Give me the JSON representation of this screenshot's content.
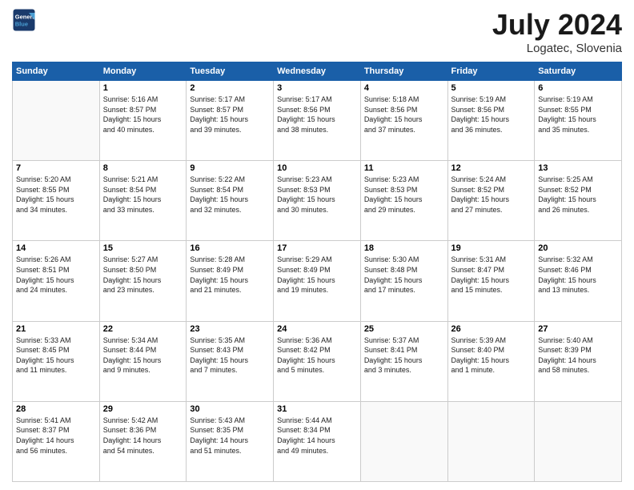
{
  "header": {
    "logo_line1": "General",
    "logo_line2": "Blue",
    "month": "July 2024",
    "location": "Logatec, Slovenia"
  },
  "weekdays": [
    "Sunday",
    "Monday",
    "Tuesday",
    "Wednesday",
    "Thursday",
    "Friday",
    "Saturday"
  ],
  "weeks": [
    [
      {
        "day": "",
        "info": ""
      },
      {
        "day": "1",
        "info": "Sunrise: 5:16 AM\nSunset: 8:57 PM\nDaylight: 15 hours\nand 40 minutes."
      },
      {
        "day": "2",
        "info": "Sunrise: 5:17 AM\nSunset: 8:57 PM\nDaylight: 15 hours\nand 39 minutes."
      },
      {
        "day": "3",
        "info": "Sunrise: 5:17 AM\nSunset: 8:56 PM\nDaylight: 15 hours\nand 38 minutes."
      },
      {
        "day": "4",
        "info": "Sunrise: 5:18 AM\nSunset: 8:56 PM\nDaylight: 15 hours\nand 37 minutes."
      },
      {
        "day": "5",
        "info": "Sunrise: 5:19 AM\nSunset: 8:56 PM\nDaylight: 15 hours\nand 36 minutes."
      },
      {
        "day": "6",
        "info": "Sunrise: 5:19 AM\nSunset: 8:55 PM\nDaylight: 15 hours\nand 35 minutes."
      }
    ],
    [
      {
        "day": "7",
        "info": "Sunrise: 5:20 AM\nSunset: 8:55 PM\nDaylight: 15 hours\nand 34 minutes."
      },
      {
        "day": "8",
        "info": "Sunrise: 5:21 AM\nSunset: 8:54 PM\nDaylight: 15 hours\nand 33 minutes."
      },
      {
        "day": "9",
        "info": "Sunrise: 5:22 AM\nSunset: 8:54 PM\nDaylight: 15 hours\nand 32 minutes."
      },
      {
        "day": "10",
        "info": "Sunrise: 5:23 AM\nSunset: 8:53 PM\nDaylight: 15 hours\nand 30 minutes."
      },
      {
        "day": "11",
        "info": "Sunrise: 5:23 AM\nSunset: 8:53 PM\nDaylight: 15 hours\nand 29 minutes."
      },
      {
        "day": "12",
        "info": "Sunrise: 5:24 AM\nSunset: 8:52 PM\nDaylight: 15 hours\nand 27 minutes."
      },
      {
        "day": "13",
        "info": "Sunrise: 5:25 AM\nSunset: 8:52 PM\nDaylight: 15 hours\nand 26 minutes."
      }
    ],
    [
      {
        "day": "14",
        "info": "Sunrise: 5:26 AM\nSunset: 8:51 PM\nDaylight: 15 hours\nand 24 minutes."
      },
      {
        "day": "15",
        "info": "Sunrise: 5:27 AM\nSunset: 8:50 PM\nDaylight: 15 hours\nand 23 minutes."
      },
      {
        "day": "16",
        "info": "Sunrise: 5:28 AM\nSunset: 8:49 PM\nDaylight: 15 hours\nand 21 minutes."
      },
      {
        "day": "17",
        "info": "Sunrise: 5:29 AM\nSunset: 8:49 PM\nDaylight: 15 hours\nand 19 minutes."
      },
      {
        "day": "18",
        "info": "Sunrise: 5:30 AM\nSunset: 8:48 PM\nDaylight: 15 hours\nand 17 minutes."
      },
      {
        "day": "19",
        "info": "Sunrise: 5:31 AM\nSunset: 8:47 PM\nDaylight: 15 hours\nand 15 minutes."
      },
      {
        "day": "20",
        "info": "Sunrise: 5:32 AM\nSunset: 8:46 PM\nDaylight: 15 hours\nand 13 minutes."
      }
    ],
    [
      {
        "day": "21",
        "info": "Sunrise: 5:33 AM\nSunset: 8:45 PM\nDaylight: 15 hours\nand 11 minutes."
      },
      {
        "day": "22",
        "info": "Sunrise: 5:34 AM\nSunset: 8:44 PM\nDaylight: 15 hours\nand 9 minutes."
      },
      {
        "day": "23",
        "info": "Sunrise: 5:35 AM\nSunset: 8:43 PM\nDaylight: 15 hours\nand 7 minutes."
      },
      {
        "day": "24",
        "info": "Sunrise: 5:36 AM\nSunset: 8:42 PM\nDaylight: 15 hours\nand 5 minutes."
      },
      {
        "day": "25",
        "info": "Sunrise: 5:37 AM\nSunset: 8:41 PM\nDaylight: 15 hours\nand 3 minutes."
      },
      {
        "day": "26",
        "info": "Sunrise: 5:39 AM\nSunset: 8:40 PM\nDaylight: 15 hours\nand 1 minute."
      },
      {
        "day": "27",
        "info": "Sunrise: 5:40 AM\nSunset: 8:39 PM\nDaylight: 14 hours\nand 58 minutes."
      }
    ],
    [
      {
        "day": "28",
        "info": "Sunrise: 5:41 AM\nSunset: 8:37 PM\nDaylight: 14 hours\nand 56 minutes."
      },
      {
        "day": "29",
        "info": "Sunrise: 5:42 AM\nSunset: 8:36 PM\nDaylight: 14 hours\nand 54 minutes."
      },
      {
        "day": "30",
        "info": "Sunrise: 5:43 AM\nSunset: 8:35 PM\nDaylight: 14 hours\nand 51 minutes."
      },
      {
        "day": "31",
        "info": "Sunrise: 5:44 AM\nSunset: 8:34 PM\nDaylight: 14 hours\nand 49 minutes."
      },
      {
        "day": "",
        "info": ""
      },
      {
        "day": "",
        "info": ""
      },
      {
        "day": "",
        "info": ""
      }
    ]
  ]
}
